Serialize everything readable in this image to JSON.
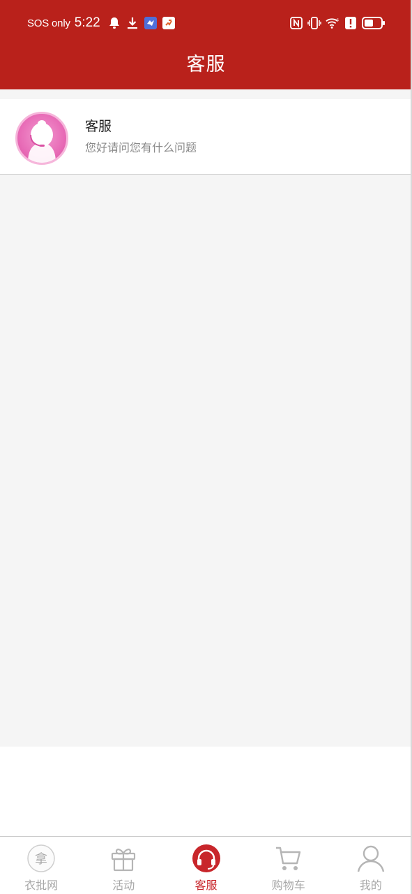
{
  "status_bar": {
    "carrier": "SOS only",
    "time": "5:22",
    "icons_left": [
      "bell-icon",
      "download-icon",
      "app-icon-blue",
      "app-icon-runner"
    ],
    "icons_right": [
      "nfc-icon",
      "vibrate-icon",
      "wifi-icon",
      "alert-icon",
      "battery-icon"
    ]
  },
  "header": {
    "title": "客服",
    "background_color": "#b9211b"
  },
  "conversation_list": {
    "items": [
      {
        "name": "客服",
        "last_message": "您好请问您有什么问题",
        "avatar": "customer-service-avatar"
      }
    ]
  },
  "tabbar": {
    "active_color": "#c8262b",
    "inactive_color": "#a8a8a8",
    "tabs": [
      {
        "label": "衣批网",
        "icon": "home-logo-icon",
        "badge_char": "拿",
        "active": false
      },
      {
        "label": "活动",
        "icon": "gift-icon",
        "active": false
      },
      {
        "label": "客服",
        "icon": "headset-icon",
        "active": true
      },
      {
        "label": "购物车",
        "icon": "cart-icon",
        "active": false
      },
      {
        "label": "我的",
        "icon": "user-icon",
        "active": false
      }
    ]
  }
}
